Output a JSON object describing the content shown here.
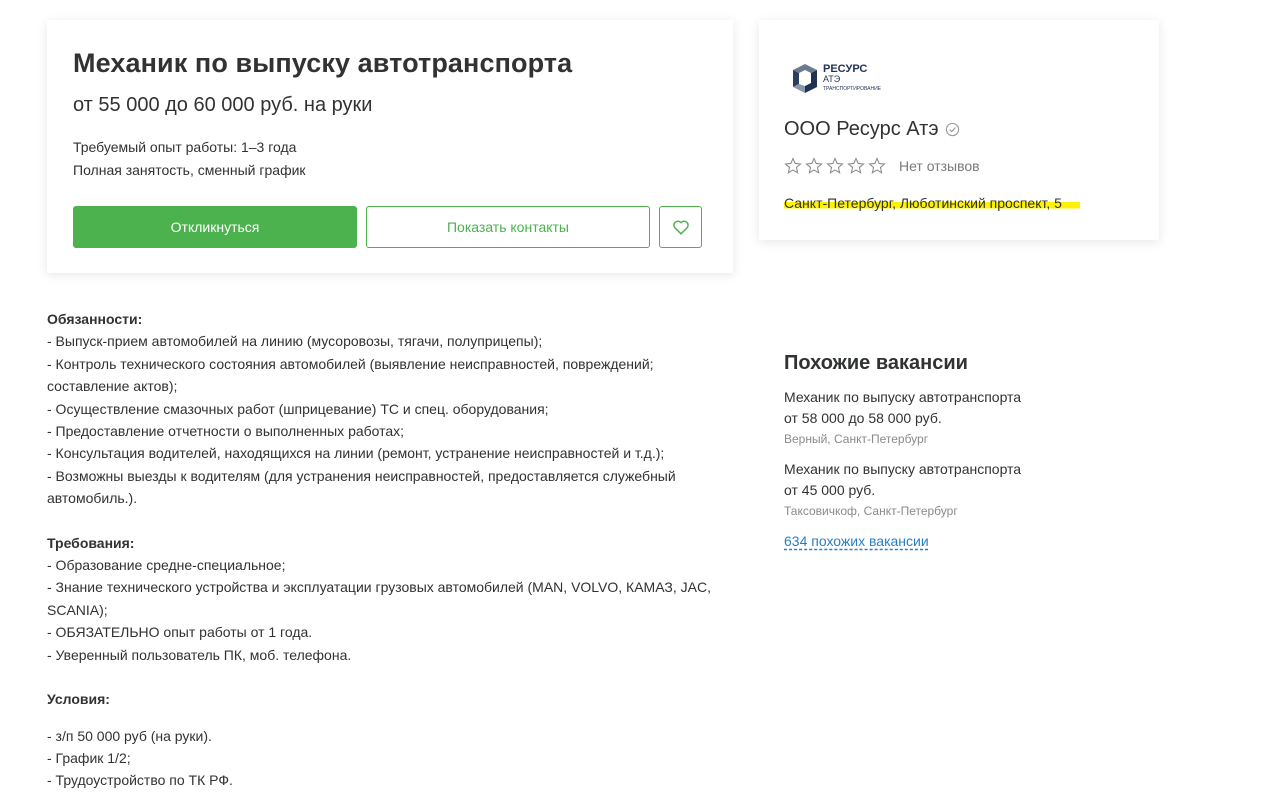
{
  "vacancy": {
    "title": "Механик по выпуску автотранспорта",
    "salary": "от 55 000 до 60 000 руб. на руки",
    "experience": "Требуемый опыт работы: 1–3 года",
    "employment": "Полная занятость, сменный график",
    "respond_label": "Откликнуться",
    "contacts_label": "Показать контакты",
    "favorite_icon": "heart-icon"
  },
  "company": {
    "logo_text_top": "РЕСУРС",
    "logo_text_mid": "АТЭ",
    "logo_text_bottom": "ТРАНСПОРТИРОВАНИЕ",
    "name": "ООО Ресурс Атэ",
    "verified_icon": "check-circle-icon",
    "rating_stars": 0,
    "reviews": "Нет отзывов",
    "address": "Санкт-Петербург, Люботинский проспект, 5"
  },
  "description": {
    "duties_title": "Обязанности:",
    "duties": [
      "- Выпуск-прием автомобилей на линию (мусоровозы, тягачи, полуприцепы);",
      "- Контроль технического состояния автомобилей (выявление неисправностей, повреждений;",
      "составление актов);",
      "- Осуществление смазочных работ (шприцевание) ТС и спец. оборудования;",
      "- Предоставление отчетности о выполненных работах;",
      "- Консультация водителей, находящихся на линии (ремонт, устранение неисправностей и т.д.);",
      "- Возможны выезды к водителям (для устранения неисправностей, предоставляется служебный",
      "автомобиль.)."
    ],
    "requirements_title": "Требования:",
    "requirements": [
      "- Образование средне-специальное;",
      "- Знание технического устройства и эксплуатации грузовых автомобилей (MAN, VOLVO, КАМАЗ, JAC,",
      "SCANIA);",
      "- ОБЯЗАТЕЛЬНО опыт работы от 1 года.",
      "- Уверенный пользователь ПК, моб. телефона."
    ],
    "conditions_title": "Условия:",
    "conditions": [
      "- з/п 50 000 руб (на руки).",
      "- График 1/2;",
      "- Трудоустройство по ТК РФ."
    ]
  },
  "similar": {
    "title": "Похожие вакансии",
    "items": [
      {
        "title": "Механик по выпуску автотранспорта",
        "salary": "от 58 000 до 58 000 руб.",
        "company": "Верный, Санкт-Петербург"
      },
      {
        "title": "Механик по выпуску автотранспорта",
        "salary": "от 45 000 руб.",
        "company": "Таксовичкоф, Санкт-Петербург"
      }
    ],
    "more_link": "634 похожих вакансии"
  },
  "colors": {
    "accent_green": "#4bb24e",
    "link_blue": "#2a7fc1",
    "highlight_yellow": "#fff200"
  }
}
